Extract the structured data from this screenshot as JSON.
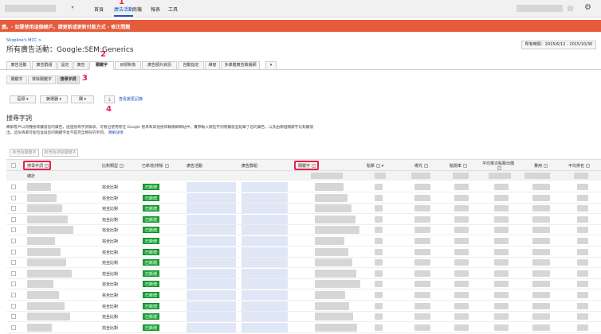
{
  "nav": {
    "items": [
      "首頁",
      "廣告活動",
      "商機",
      "報表",
      "工具"
    ],
    "active_index": 1
  },
  "banner": {
    "text": "廣。- 如要使用這個帳戶，請更新或更新付款方式 - 修正問題"
  },
  "account": {
    "breadcrumb": "Shopline's MCC >",
    "title": "所有廣告活動：Google:SEM:Generics",
    "date_range": "所有時間：2015/6/12 - 2015/10/30"
  },
  "markers": [
    "1",
    "2",
    "3",
    "4"
  ],
  "tabs": [
    "廣告活動",
    "廣告群組",
    "設定",
    "廣告",
    "關鍵字",
    "目標對象",
    "廣告額外資訊",
    "自動指定",
    "維度",
    "多媒體廣告聯播網",
    "▾"
  ],
  "active_tab_index": 4,
  "subtabs": [
    "關鍵字",
    "排除關鍵字",
    "搜尋字詞"
  ],
  "active_subtab_index": 2,
  "toolbar": {
    "segment": "區隔 ▾",
    "filter": "篩選器 ▾",
    "columns": "欄 ▾",
    "download_icon": "⤓",
    "change_history": "查看變更記錄"
  },
  "section": {
    "title": "搜尋字詞",
    "desc_line1": "瞭解客戶以何種搜尋觸發您的廣告。透過搜尋字詞報表，可看出使用者在 Google 搜尋和其他搜尋聯播網網站中，實際輸入哪些字詞而觸發並點擊了您的廣告，以及由哪個關鍵字比對觸發",
    "desc_line2": "出。這份清單可能包含與您的關鍵字並不是完全相符的字詞。",
    "learn_more": "瞭解詳情"
  },
  "actions": {
    "add_keyword": "新增為關鍵字",
    "add_negative": "新增為排除關鍵字"
  },
  "table": {
    "headers": {
      "search_term": "搜尋字詞",
      "match_type": "比對類型",
      "added_excluded": "已新增/排除",
      "campaign": "廣告活動",
      "ad_group": "廣告群組",
      "keyword": "關鍵字",
      "clicks": "點擊",
      "impressions": "曝光",
      "ctr": "點閱率",
      "avg_cpc": "平均單次點擊出價",
      "cost": "費用",
      "avg_pos": "平均排名"
    },
    "total_label": "總計",
    "rows": [
      {
        "match": "完全比對",
        "status": "已新增"
      },
      {
        "match": "完全比對",
        "status": "已新增"
      },
      {
        "match": "完全比對",
        "status": "已新增"
      },
      {
        "match": "完全比對",
        "status": "已新增"
      },
      {
        "match": "完全比對",
        "status": "已新增"
      },
      {
        "match": "完全比對",
        "status": "已新增"
      },
      {
        "match": "完全比對",
        "status": "已新增"
      },
      {
        "match": "完全比對",
        "status": "已新增"
      },
      {
        "match": "完全比對",
        "status": "已新增"
      },
      {
        "match": "完全比對",
        "status": "已新增"
      },
      {
        "match": "完全比對",
        "status": "已新增"
      },
      {
        "match": "完全比對",
        "status": "已新增"
      },
      {
        "match": "完全比對",
        "status": "已新增"
      },
      {
        "match": "完全比對",
        "status": "已新增"
      }
    ]
  },
  "colors": {
    "accent": "#1a55c9",
    "banner": "#e55b3b",
    "marker": "#e8204a",
    "status": "#1fa83a"
  },
  "icons": {
    "settings": "gear-icon",
    "download": "download-icon"
  }
}
